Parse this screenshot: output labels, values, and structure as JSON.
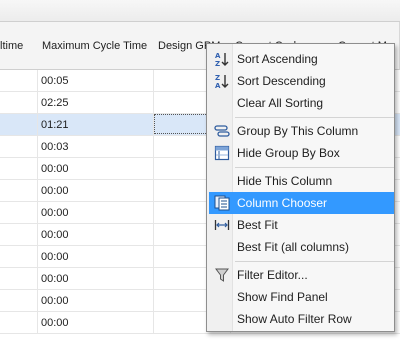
{
  "columns": [
    "ltime",
    "Maximum Cycle Time",
    "Design GPM",
    "Current Cycle",
    "Current M"
  ],
  "rows": [
    {
      "time": "00:05",
      "selected": false
    },
    {
      "time": "02:25",
      "selected": false
    },
    {
      "time": "01:21",
      "selected": true
    },
    {
      "time": "00:03",
      "selected": false
    },
    {
      "time": "00:00",
      "selected": false
    },
    {
      "time": "00:00",
      "selected": false
    },
    {
      "time": "00:00",
      "selected": false
    },
    {
      "time": "00:00",
      "selected": false
    },
    {
      "time": "00:00",
      "selected": false
    },
    {
      "time": "00:00",
      "selected": false
    },
    {
      "time": "00:00",
      "selected": false
    },
    {
      "time": "00:00",
      "selected": false
    }
  ],
  "edge_values": {
    "right_zero": "0"
  },
  "context_menu": {
    "items": [
      {
        "label": "Sort Ascending",
        "icon": "sort-ascending-icon"
      },
      {
        "label": "Sort Descending",
        "icon": "sort-descending-icon"
      },
      {
        "label": "Clear All Sorting",
        "icon": null
      },
      {
        "label": "Group By This Column",
        "icon": "group-by-icon"
      },
      {
        "label": "Hide Group By Box",
        "icon": "group-box-icon"
      },
      {
        "label": "Hide This Column",
        "icon": null
      },
      {
        "label": "Column Chooser",
        "icon": "column-chooser-icon",
        "highlighted": true
      },
      {
        "label": "Best Fit",
        "icon": "best-fit-icon"
      },
      {
        "label": "Best Fit (all columns)",
        "icon": null
      },
      {
        "label": "Filter Editor...",
        "icon": "filter-icon"
      },
      {
        "label": "Show Find Panel",
        "icon": null
      },
      {
        "label": "Show Auto Filter Row",
        "icon": null
      }
    ],
    "highlight_color": "#3399ff"
  }
}
